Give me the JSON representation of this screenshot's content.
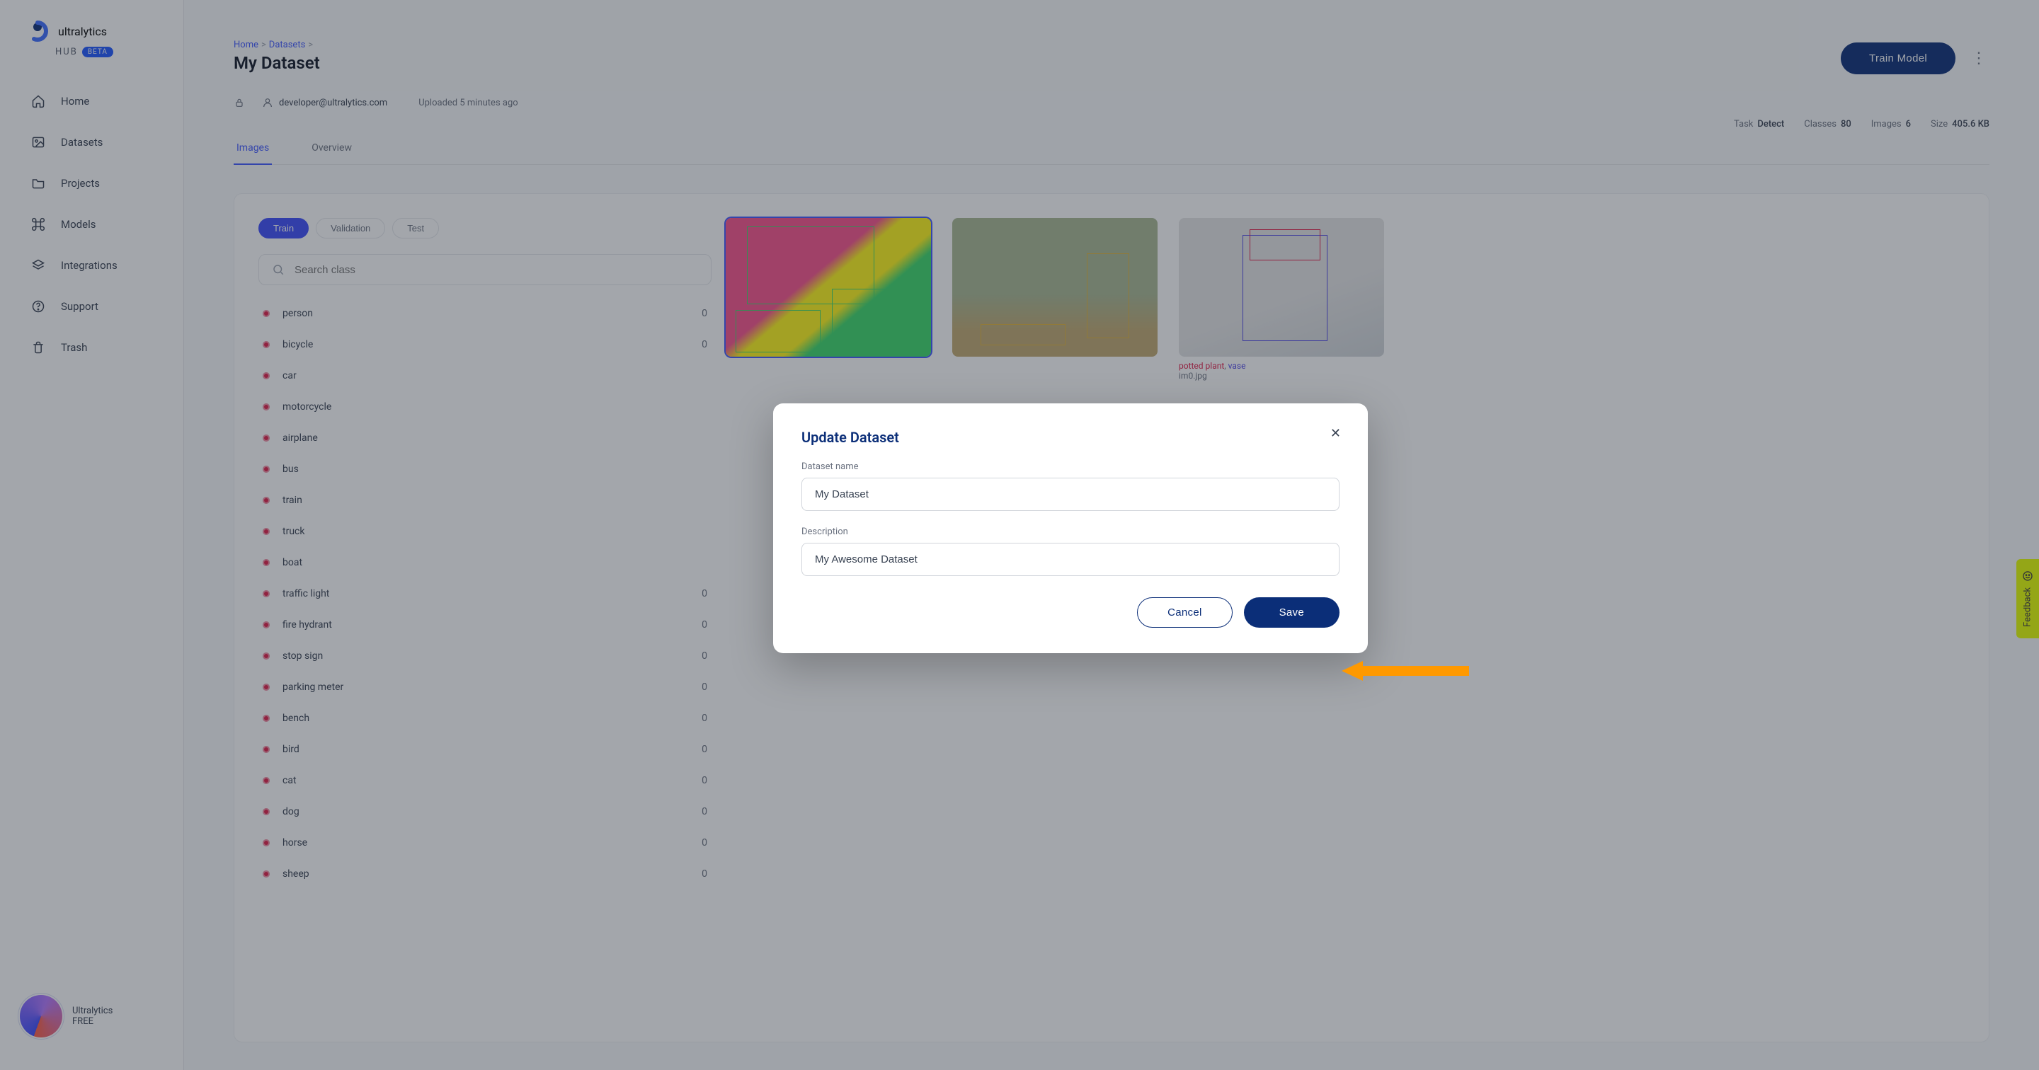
{
  "brand": {
    "name": "ultralytics",
    "hub": "HUB",
    "beta": "BETA"
  },
  "nav": {
    "home": "Home",
    "datasets": "Datasets",
    "projects": "Projects",
    "models": "Models",
    "integrations": "Integrations",
    "support": "Support",
    "trash": "Trash"
  },
  "user": {
    "name": "Ultralytics",
    "plan": "FREE"
  },
  "crumbs": {
    "home": "Home",
    "datasets": "Datasets"
  },
  "page": {
    "title": "My Dataset"
  },
  "actions": {
    "train": "Train Model"
  },
  "owner": {
    "email": "developer@ultralytics.com",
    "uploaded": "Uploaded 5 minutes ago"
  },
  "stats": {
    "task_label": "Task",
    "task": "Detect",
    "classes_label": "Classes",
    "classes": "80",
    "images_label": "Images",
    "images": "6",
    "size_label": "Size",
    "size": "405.6 KB"
  },
  "tabs": {
    "images": "Images",
    "overview": "Overview"
  },
  "splits": {
    "train": "Train",
    "validation": "Validation",
    "test": "Test"
  },
  "search": {
    "placeholder": "Search class"
  },
  "classes": [
    {
      "name": "person",
      "count": "0"
    },
    {
      "name": "bicycle",
      "count": "0"
    },
    {
      "name": "car",
      "count": ""
    },
    {
      "name": "motorcycle",
      "count": ""
    },
    {
      "name": "airplane",
      "count": ""
    },
    {
      "name": "bus",
      "count": ""
    },
    {
      "name": "train",
      "count": ""
    },
    {
      "name": "truck",
      "count": ""
    },
    {
      "name": "boat",
      "count": ""
    },
    {
      "name": "traffic light",
      "count": "0"
    },
    {
      "name": "fire hydrant",
      "count": "0"
    },
    {
      "name": "stop sign",
      "count": "0"
    },
    {
      "name": "parking meter",
      "count": "0"
    },
    {
      "name": "bench",
      "count": "0"
    },
    {
      "name": "bird",
      "count": "0"
    },
    {
      "name": "cat",
      "count": "0"
    },
    {
      "name": "dog",
      "count": "0"
    },
    {
      "name": "horse",
      "count": "0"
    },
    {
      "name": "sheep",
      "count": "0"
    }
  ],
  "thumb3": {
    "tag1": "potted plant",
    "tag2": "vase",
    "file": "im0.jpg",
    "sep": ", "
  },
  "modal": {
    "title": "Update Dataset",
    "name_label": "Dataset name",
    "name_value": "My Dataset",
    "desc_label": "Description",
    "desc_value": "My Awesome Dataset",
    "cancel": "Cancel",
    "save": "Save"
  },
  "feedback": "Feedback"
}
